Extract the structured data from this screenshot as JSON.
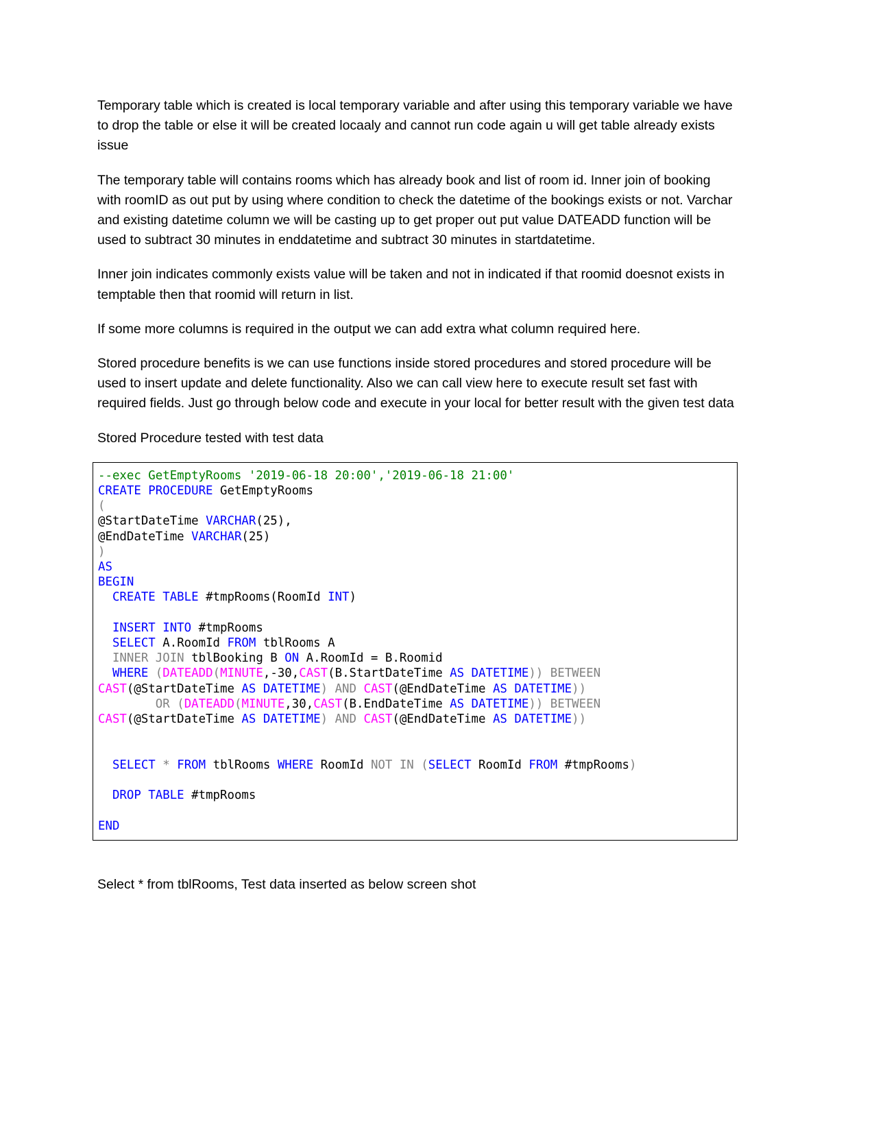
{
  "document": {
    "paragraphs": [
      "Temporary table which is created is local temporary variable and after using this temporary variable we have to drop the table or else it will be created locaaly and cannot run code again u will get table already exists issue",
      "The temporary table will contains rooms which has already book and list of room id. Inner join of booking with roomID as out put by using where condition to check the datetime of the bookings exists or not. Varchar and existing datetime column we will be casting up to get proper out put value DATEADD function will be used to subtract 30 minutes in enddatetime and subtract 30 minutes in startdatetime.",
      "Inner join indicates commonly exists value will be taken and not in indicated if that roomid doesnot exists in temptable then that roomid will return in list.",
      "If some more columns is required in the output we can add extra what column required here.",
      "Stored procedure benefits is we can use functions inside stored procedures and stored procedure will be used to insert update and delete functionality. Also we can call view here to execute result set fast with required fields. Just go through below code and execute in your local for better result with the given test data",
      "Stored Procedure tested with test data"
    ],
    "trailing_paragraph": "Select * from tblRooms, Test data inserted as below screen shot"
  },
  "code_block": {
    "language": "sql",
    "colors": {
      "keyword": "#0000ff",
      "function": "#ff00ff",
      "comment": "#008000",
      "gray_keyword": "#808080",
      "plain": "#000000",
      "border": "#000000",
      "background": "#ffffff"
    },
    "plain_text": "--exec GetEmptyRooms '2019-06-18 20:00','2019-06-18 21:00'\nCREATE PROCEDURE GetEmptyRooms\n(\n@StartDateTime VARCHAR(25),\n@EndDateTime VARCHAR(25)\n)\nAS\nBEGIN\n  CREATE TABLE #tmpRooms(RoomId INT)\n\n  INSERT INTO #tmpRooms\n  SELECT A.RoomId FROM tblRooms A\n  INNER JOIN tblBooking B ON A.RoomId = B.Roomid\n  WHERE (DATEADD(MINUTE,-30,CAST(B.StartDateTime AS DATETIME)) BETWEEN\nCAST(@StartDateTime AS DATETIME) AND CAST(@EndDateTime AS DATETIME))\n        OR (DATEADD(MINUTE,30,CAST(B.EndDateTime AS DATETIME)) BETWEEN\nCAST(@StartDateTime AS DATETIME) AND CAST(@EndDateTime AS DATETIME))\n\n\n  SELECT * FROM tblRooms WHERE RoomId NOT IN (SELECT RoomId FROM #tmpRooms)\n\n  DROP TABLE #tmpRooms\n\nEND",
    "lines": [
      [
        {
          "t": "--exec GetEmptyRooms '2019-06-18 20:00','2019-06-18 21:00'",
          "c": "cmt"
        }
      ],
      [
        {
          "t": "CREATE PROCEDURE",
          "c": "kw"
        },
        {
          "t": " GetEmptyRooms",
          "c": "pl"
        }
      ],
      [
        {
          "t": "(",
          "c": "gray"
        }
      ],
      [
        {
          "t": "@StartDateTime ",
          "c": "pl"
        },
        {
          "t": "VARCHAR",
          "c": "kw"
        },
        {
          "t": "(25),",
          "c": "pl"
        }
      ],
      [
        {
          "t": "@EndDateTime ",
          "c": "pl"
        },
        {
          "t": "VARCHAR",
          "c": "kw"
        },
        {
          "t": "(25)",
          "c": "pl"
        }
      ],
      [
        {
          "t": ")",
          "c": "gray"
        }
      ],
      [
        {
          "t": "AS",
          "c": "kw"
        }
      ],
      [
        {
          "t": "BEGIN",
          "c": "kw"
        }
      ],
      [
        {
          "t": "  ",
          "c": "pl"
        },
        {
          "t": "CREATE TABLE",
          "c": "kw"
        },
        {
          "t": " #tmpRooms(RoomId ",
          "c": "pl"
        },
        {
          "t": "INT",
          "c": "kw"
        },
        {
          "t": ")",
          "c": "pl"
        }
      ],
      [
        {
          "t": "",
          "c": "pl"
        }
      ],
      [
        {
          "t": "  ",
          "c": "pl"
        },
        {
          "t": "INSERT INTO",
          "c": "kw"
        },
        {
          "t": " #tmpRooms",
          "c": "pl"
        }
      ],
      [
        {
          "t": "  ",
          "c": "pl"
        },
        {
          "t": "SELECT",
          "c": "kw"
        },
        {
          "t": " A.RoomId ",
          "c": "pl"
        },
        {
          "t": "FROM",
          "c": "kw"
        },
        {
          "t": " tblRooms A",
          "c": "pl"
        }
      ],
      [
        {
          "t": "  ",
          "c": "pl"
        },
        {
          "t": "INNER JOIN",
          "c": "gray"
        },
        {
          "t": " tblBooking B ",
          "c": "pl"
        },
        {
          "t": "ON",
          "c": "kw"
        },
        {
          "t": " A.RoomId = B.Roomid",
          "c": "pl"
        }
      ],
      [
        {
          "t": "  ",
          "c": "pl"
        },
        {
          "t": "WHERE",
          "c": "kw"
        },
        {
          "t": " ",
          "c": "pl"
        },
        {
          "t": "(",
          "c": "gray"
        },
        {
          "t": "DATEADD",
          "c": "fn"
        },
        {
          "t": "(",
          "c": "gray"
        },
        {
          "t": "MINUTE",
          "c": "fn"
        },
        {
          "t": ",-30,",
          "c": "pl"
        },
        {
          "t": "CAST",
          "c": "fn"
        },
        {
          "t": "(B.StartDateTime ",
          "c": "pl"
        },
        {
          "t": "AS DATETIME",
          "c": "kw"
        },
        {
          "t": "))",
          "c": "gray"
        },
        {
          "t": " ",
          "c": "pl"
        },
        {
          "t": "BETWEEN",
          "c": "gray"
        }
      ],
      [
        {
          "t": "CAST",
          "c": "fn"
        },
        {
          "t": "(@StartDateTime ",
          "c": "pl"
        },
        {
          "t": "AS DATETIME",
          "c": "kw"
        },
        {
          "t": ")",
          "c": "gray"
        },
        {
          "t": " ",
          "c": "pl"
        },
        {
          "t": "AND",
          "c": "gray"
        },
        {
          "t": " ",
          "c": "pl"
        },
        {
          "t": "CAST",
          "c": "fn"
        },
        {
          "t": "(@EndDateTime ",
          "c": "pl"
        },
        {
          "t": "AS DATETIME",
          "c": "kw"
        },
        {
          "t": "))",
          "c": "gray"
        }
      ],
      [
        {
          "t": "        ",
          "c": "pl"
        },
        {
          "t": "OR",
          "c": "gray"
        },
        {
          "t": " ",
          "c": "pl"
        },
        {
          "t": "(",
          "c": "gray"
        },
        {
          "t": "DATEADD",
          "c": "fn"
        },
        {
          "t": "(",
          "c": "gray"
        },
        {
          "t": "MINUTE",
          "c": "fn"
        },
        {
          "t": ",30,",
          "c": "pl"
        },
        {
          "t": "CAST",
          "c": "fn"
        },
        {
          "t": "(B.EndDateTime ",
          "c": "pl"
        },
        {
          "t": "AS DATETIME",
          "c": "kw"
        },
        {
          "t": "))",
          "c": "gray"
        },
        {
          "t": " ",
          "c": "pl"
        },
        {
          "t": "BETWEEN",
          "c": "gray"
        }
      ],
      [
        {
          "t": "CAST",
          "c": "fn"
        },
        {
          "t": "(@StartDateTime ",
          "c": "pl"
        },
        {
          "t": "AS DATETIME",
          "c": "kw"
        },
        {
          "t": ")",
          "c": "gray"
        },
        {
          "t": " ",
          "c": "pl"
        },
        {
          "t": "AND",
          "c": "gray"
        },
        {
          "t": " ",
          "c": "pl"
        },
        {
          "t": "CAST",
          "c": "fn"
        },
        {
          "t": "(@EndDateTime ",
          "c": "pl"
        },
        {
          "t": "AS DATETIME",
          "c": "kw"
        },
        {
          "t": "))",
          "c": "gray"
        }
      ],
      [
        {
          "t": "",
          "c": "pl"
        }
      ],
      [
        {
          "t": "",
          "c": "pl"
        }
      ],
      [
        {
          "t": "  ",
          "c": "pl"
        },
        {
          "t": "SELECT",
          "c": "kw"
        },
        {
          "t": " ",
          "c": "pl"
        },
        {
          "t": "*",
          "c": "gray"
        },
        {
          "t": " ",
          "c": "pl"
        },
        {
          "t": "FROM",
          "c": "kw"
        },
        {
          "t": " tblRooms ",
          "c": "pl"
        },
        {
          "t": "WHERE",
          "c": "kw"
        },
        {
          "t": " RoomId ",
          "c": "pl"
        },
        {
          "t": "NOT IN",
          "c": "gray"
        },
        {
          "t": " ",
          "c": "pl"
        },
        {
          "t": "(",
          "c": "gray"
        },
        {
          "t": "SELECT",
          "c": "kw"
        },
        {
          "t": " RoomId ",
          "c": "pl"
        },
        {
          "t": "FROM",
          "c": "kw"
        },
        {
          "t": " #tmpRooms",
          "c": "pl"
        },
        {
          "t": ")",
          "c": "gray"
        }
      ],
      [
        {
          "t": "",
          "c": "pl"
        }
      ],
      [
        {
          "t": "  ",
          "c": "pl"
        },
        {
          "t": "DROP TABLE",
          "c": "kw"
        },
        {
          "t": " #tmpRooms",
          "c": "pl"
        }
      ],
      [
        {
          "t": "",
          "c": "pl"
        }
      ],
      [
        {
          "t": "END",
          "c": "kw"
        }
      ]
    ]
  }
}
